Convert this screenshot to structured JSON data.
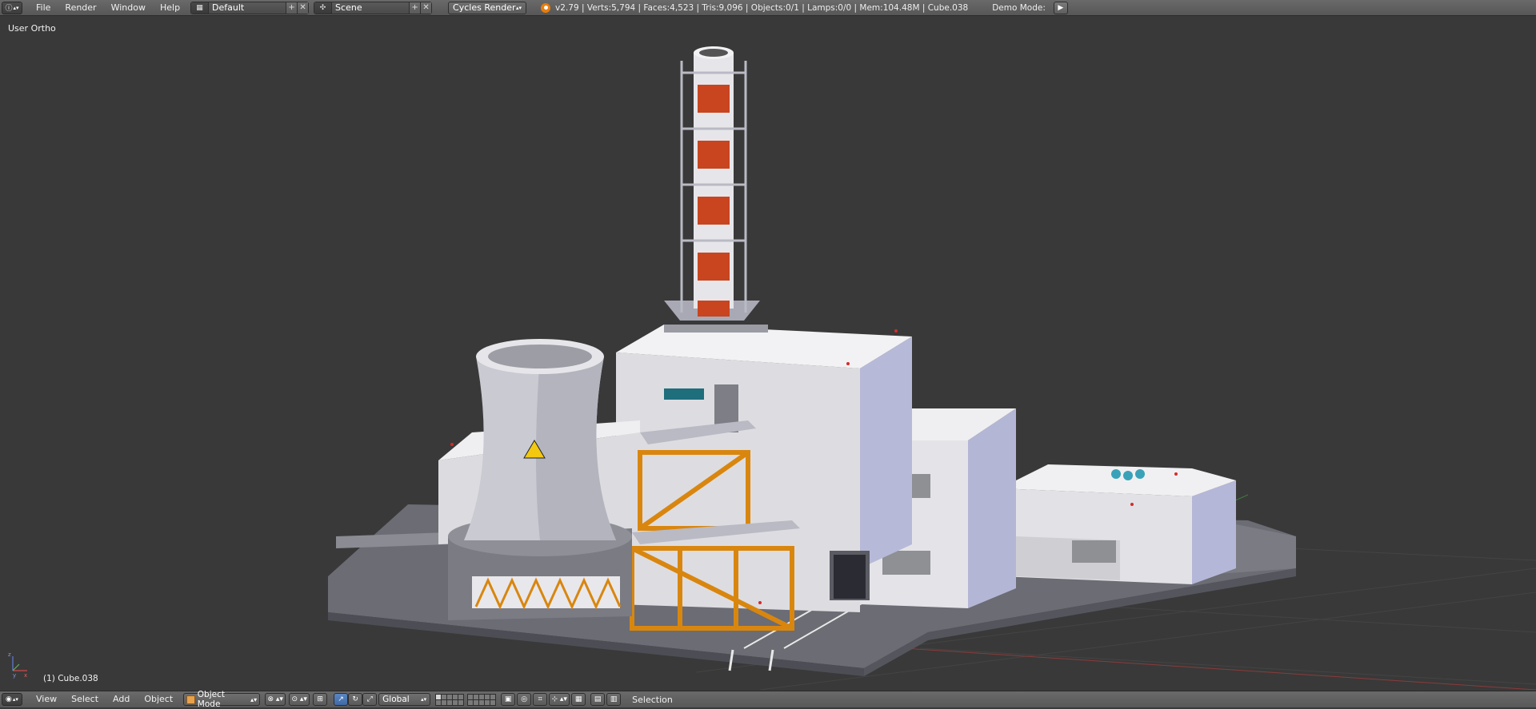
{
  "top_bar": {
    "menus": [
      "File",
      "Render",
      "Window",
      "Help"
    ],
    "screen_layout": "Default",
    "scene": "Scene",
    "render_engine": "Cycles Render",
    "stats": "v2.79 | Verts:5,794 | Faces:4,523 | Tris:9,096 | Objects:0/1 | Lamps:0/0 | Mem:104.48M | Cube.038",
    "demo_mode_label": "Demo Mode:"
  },
  "viewport": {
    "view_label": "User Ortho",
    "object_label": "(1) Cube.038",
    "background": "#393939"
  },
  "bottom_bar": {
    "menus": [
      "View",
      "Select",
      "Add",
      "Object"
    ],
    "mode": "Object Mode",
    "orientation": "Global",
    "selection_label": "Selection"
  },
  "colors": {
    "orange": "#d9860f",
    "chimney_red": "#c8451f",
    "building": "#cfd0d8",
    "ground": "#6f7079",
    "accent_blue": "#5680c2"
  }
}
